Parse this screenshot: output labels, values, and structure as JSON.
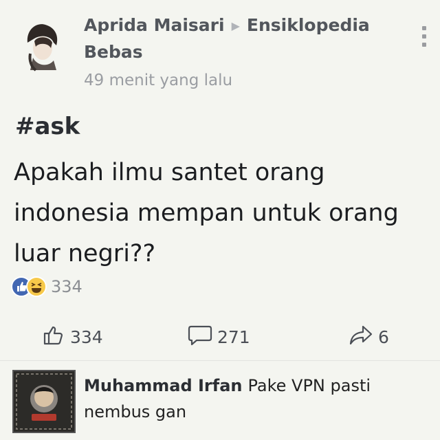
{
  "post": {
    "author": "Aprida Maisari",
    "group": "Ensiklopedia Bebas",
    "timestamp": "49 menit yang lalu",
    "hashtag": "#ask",
    "text": "Apakah ilmu santet orang indonesia mempan untuk orang luar negri??",
    "reaction_count": "334"
  },
  "actions": {
    "like_count": "334",
    "comment_count": "271",
    "share_count": "6"
  },
  "comment": {
    "author": "Muhammad Irfan",
    "text": "Pake VPN pasti nembus gan"
  },
  "colors": {
    "background": "#f4f5f0",
    "like_blue": "#4267b2",
    "haha_yellow": "#f7c94a",
    "muted_text": "#9a9da2"
  },
  "icons": [
    "avatar",
    "share-arrow-icon",
    "more-options-icon",
    "like-reaction-icon",
    "haha-reaction-icon",
    "like-icon",
    "comment-icon",
    "share-icon"
  ]
}
